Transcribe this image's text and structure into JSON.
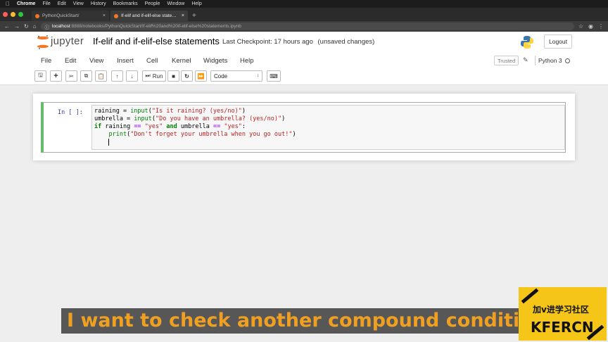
{
  "os_menubar": {
    "apple": "",
    "app": "Chrome",
    "items": [
      "File",
      "Edit",
      "View",
      "History",
      "Bookmarks",
      "People",
      "Window",
      "Help"
    ]
  },
  "browser": {
    "tabs": [
      {
        "label": "PythonQuickStart/",
        "active": false
      },
      {
        "label": "If-elif and if-elif-else statemen",
        "active": true
      }
    ],
    "new_tab": "+",
    "address": {
      "host": "localhost",
      "path": ":8888/notebooks/PythonQuickStart/If-elif%20and%20if-elif-else%20statements.ipynb"
    }
  },
  "jupyter": {
    "logo_text": "jupyter",
    "notebook_title": "If-elif and if-elif-else statements",
    "checkpoint": "Last Checkpoint: 17 hours ago",
    "unsaved": "(unsaved changes)",
    "logout": "Logout",
    "menu": [
      "File",
      "Edit",
      "View",
      "Insert",
      "Cell",
      "Kernel",
      "Widgets",
      "Help"
    ],
    "trusted": "Trusted",
    "kernel": "Python 3",
    "toolbar": {
      "run_label": "Run",
      "cell_type": "Code"
    },
    "cell": {
      "prompt": "In [ ]:",
      "code_lines": [
        "raining = input(\"Is it raining? (yes/no)\")",
        "umbrella = input(\"Do you have an umbrella? (yes/no)\")",
        "if raining == \"yes\" and umbrella == \"yes\":",
        "    print(\"Don't forget your umbrella when you go out!\")",
        "    "
      ]
    }
  },
  "subtitle": "I want to check another compound condition",
  "watermark": {
    "top": "加v进学习社区",
    "bottom": "KFERCN"
  },
  "colors": {
    "cell_border_active": "#66bb6a",
    "subtitle_text": "#f0a020",
    "watermark_bg": "#f5c518"
  }
}
